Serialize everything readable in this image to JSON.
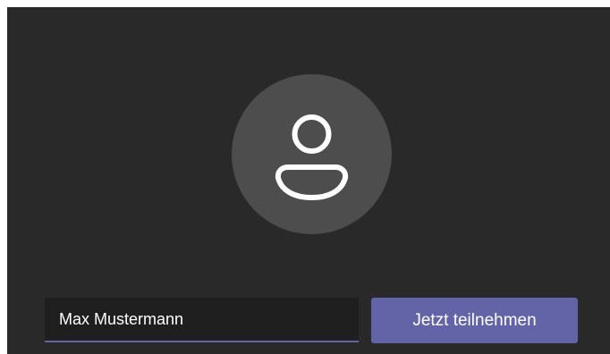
{
  "prejoin": {
    "avatar_icon": "user-icon",
    "name_input": {
      "value": "Max Mustermann",
      "placeholder": "Max Mustermann"
    },
    "join_label": "Jetzt teilnehmen"
  },
  "colors": {
    "panel_background": "#292929",
    "avatar_background": "#4e4d4e",
    "accent": "#6264a7"
  }
}
